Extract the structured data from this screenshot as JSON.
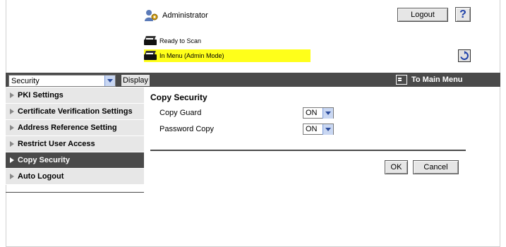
{
  "header": {
    "user_label": "Administrator",
    "logout_label": "Logout",
    "help_label": "?",
    "status_ready": "Ready to Scan",
    "status_menu": "In Menu (Admin Mode)",
    "status_menu_color": "#ffff1a",
    "icons": [
      "admin-icon",
      "printer-icon",
      "refresh-icon",
      "help-icon"
    ]
  },
  "navbar": {
    "category_value": "Security",
    "display_label": "Display",
    "main_menu_label": "To Main Menu"
  },
  "sidebar": {
    "items": [
      {
        "label": "PKI Settings",
        "active": false
      },
      {
        "label": "Certificate Verification Settings",
        "active": false
      },
      {
        "label": "Address Reference Setting",
        "active": false
      },
      {
        "label": "Restrict User Access",
        "active": false
      },
      {
        "label": "Copy Security",
        "active": true
      },
      {
        "label": "Auto Logout",
        "active": false
      }
    ]
  },
  "main": {
    "title": "Copy Security",
    "fields": [
      {
        "label": "Copy Guard",
        "value": "ON"
      },
      {
        "label": "Password Copy",
        "value": "ON"
      }
    ],
    "ok_label": "OK",
    "cancel_label": "Cancel"
  },
  "colors": {
    "bar": "#4a4a4a",
    "sidebar_bg": "#e7e7e7",
    "highlight": "#ffff1a",
    "dropdown_accent": "#c9d7f2"
  }
}
